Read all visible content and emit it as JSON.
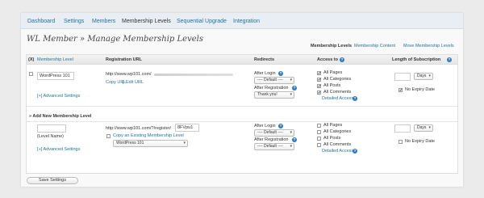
{
  "nav": {
    "dashboard": "Dashboard",
    "settings": "Settings",
    "members": "Members",
    "membership_levels": "Membership Levels",
    "sequential_upgrade": "Sequential Upgrade",
    "integration": "Integration"
  },
  "page": {
    "title": "WL Member » Manage Membership Levels",
    "sub_levels": "Membership Levels",
    "sub_content": "Membership Content",
    "sub_move": "Move Membership Levels"
  },
  "table": {
    "headers": {
      "id": "(X)",
      "level": "Membership Level",
      "url": "Registration URL",
      "redirects": "Redirects",
      "access": "Access to",
      "length": "Length of Subscription"
    }
  },
  "level_row": {
    "name": "WordPress 101",
    "url": "http://www.wp101.com/",
    "copy_url": "Copy URL",
    "separator": "|",
    "edit_url": "Edit URL",
    "advanced": "[+] Advanced Settings",
    "after_login": "After Login",
    "after_login_value": "---- Default ----",
    "after_registration": "After Registration",
    "after_registration_value": "Thank you!",
    "access": [
      "All Pages",
      "All Categories",
      "All Posts",
      "All Comments"
    ],
    "detailed_access": "Detailed Access",
    "length_unit": "Days",
    "no_expiry": "No Expiry Date"
  },
  "add_section": {
    "title": "» Add New Membership Level",
    "level_name_label": "(Level Name)",
    "advanced": "[+] Advanced Settings",
    "url_prefix": "http://www.wp101.com/?/register/",
    "url_code": "8FVpu1",
    "copy_existing": "Copy an Existing Membership Level",
    "copy_existing_value": "WordPress 101",
    "after_login": "After Login",
    "after_login_value": "---- Default ----",
    "after_registration": "After Registration",
    "after_registration_value": "---- Default ----",
    "access": [
      "All Pages",
      "All Categories",
      "All Posts",
      "All Comments"
    ],
    "detailed_access": "Detailed Access",
    "length_unit": "Days",
    "no_expiry": "No Expiry Date"
  },
  "save_button": "Save Settings",
  "help_icon_glyph": "?",
  "check_glyph": "✔",
  "colors": {
    "link": "#21759b",
    "help_icon": "#2e7bbf",
    "nav_bg": "#e8eef3"
  }
}
